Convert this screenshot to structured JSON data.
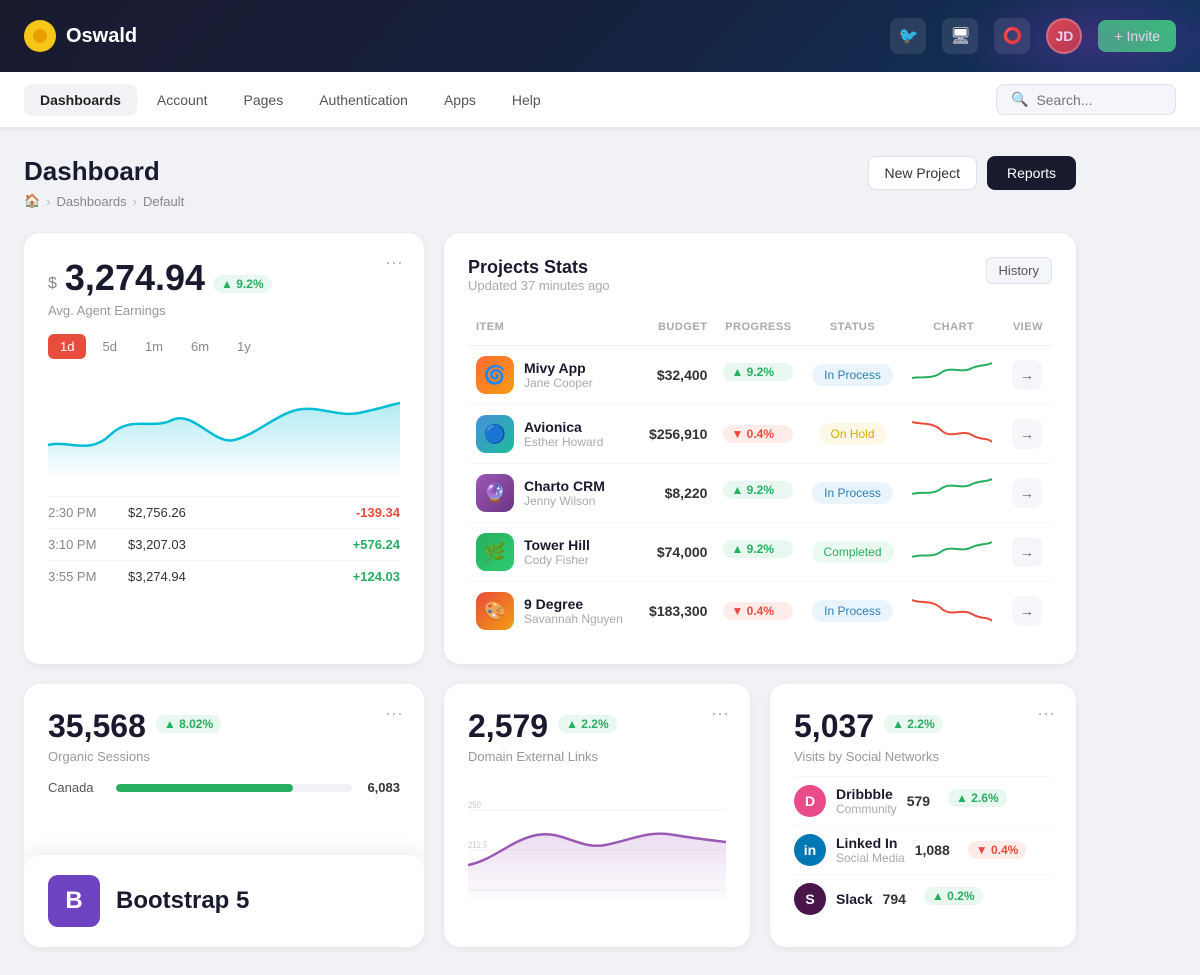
{
  "header": {
    "logo_text": "Oswald",
    "invite_label": "+ Invite"
  },
  "nav": {
    "items": [
      {
        "id": "dashboards",
        "label": "Dashboards",
        "active": true
      },
      {
        "id": "account",
        "label": "Account",
        "active": false
      },
      {
        "id": "pages",
        "label": "Pages",
        "active": false
      },
      {
        "id": "authentication",
        "label": "Authentication",
        "active": false
      },
      {
        "id": "apps",
        "label": "Apps",
        "active": false
      },
      {
        "id": "help",
        "label": "Help",
        "active": false
      }
    ],
    "search_placeholder": "Search..."
  },
  "page": {
    "title": "Dashboard",
    "breadcrumb": [
      "🏠",
      "Dashboards",
      "Default"
    ],
    "btn_new_project": "New Project",
    "btn_reports": "Reports"
  },
  "earnings_card": {
    "currency": "$",
    "amount": "3,274.94",
    "badge": "▲ 9.2%",
    "subtitle": "Avg. Agent Earnings",
    "time_filters": [
      "1d",
      "5d",
      "1m",
      "6m",
      "1y"
    ],
    "active_filter": "1d",
    "rows": [
      {
        "time": "2:30 PM",
        "value": "$2,756.26",
        "change": "-139.34",
        "positive": false
      },
      {
        "time": "3:10 PM",
        "value": "$3,207.03",
        "change": "+576.24",
        "positive": true
      },
      {
        "time": "3:55 PM",
        "value": "$3,274.94",
        "change": "+124.03",
        "positive": true
      }
    ]
  },
  "projects_card": {
    "title": "Projects Stats",
    "updated": "Updated 37 minutes ago",
    "btn_history": "History",
    "columns": [
      "ITEM",
      "BUDGET",
      "PROGRESS",
      "STATUS",
      "CHART",
      "VIEW"
    ],
    "rows": [
      {
        "name": "Mivy App",
        "person": "Jane Cooper",
        "budget": "$32,400",
        "progress": "▲ 9.2%",
        "progress_up": true,
        "status": "In Process",
        "status_class": "status-in-process",
        "icon": "🌀",
        "icon_bg": "#ff6b35"
      },
      {
        "name": "Avionica",
        "person": "Esther Howard",
        "budget": "$256,910",
        "progress": "▼ 0.4%",
        "progress_up": false,
        "status": "On Hold",
        "status_class": "status-on-hold",
        "icon": "🔵",
        "icon_bg": "#4a90d9"
      },
      {
        "name": "Charto CRM",
        "person": "Jenny Wilson",
        "budget": "$8,220",
        "progress": "▲ 9.2%",
        "progress_up": true,
        "status": "In Process",
        "status_class": "status-in-process",
        "icon": "🔮",
        "icon_bg": "#9b59b6"
      },
      {
        "name": "Tower Hill",
        "person": "Cody Fisher",
        "budget": "$74,000",
        "progress": "▲ 9.2%",
        "progress_up": true,
        "status": "Completed",
        "status_class": "status-completed",
        "icon": "🌿",
        "icon_bg": "#27ae60"
      },
      {
        "name": "9 Degree",
        "person": "Savannah Nguyen",
        "budget": "$183,300",
        "progress": "▼ 0.4%",
        "progress_up": false,
        "status": "In Process",
        "status_class": "status-in-process",
        "icon": "🎨",
        "icon_bg": "#e74c3c"
      }
    ]
  },
  "organic_card": {
    "number": "35,568",
    "badge": "▲ 8.02%",
    "badge_positive": true,
    "label": "Organic Sessions",
    "geo_items": [
      {
        "name": "Canada",
        "value": "6,083",
        "pct": 75
      }
    ]
  },
  "domain_card": {
    "number": "2,579",
    "badge": "▲ 2.2%",
    "badge_positive": true,
    "label": "Domain External Links"
  },
  "social_card": {
    "number": "5,037",
    "badge": "▲ 2.2%",
    "badge_positive": true,
    "label": "Visits by Social Networks",
    "networks": [
      {
        "name": "Dribbble",
        "sub": "Community",
        "count": "579",
        "change": "▲ 2.6%",
        "positive": true,
        "color": "#ea4c89"
      },
      {
        "name": "Linked In",
        "sub": "Social Media",
        "count": "1,088",
        "change": "▼ 0.4%",
        "positive": false,
        "color": "#0077b5"
      },
      {
        "name": "Slack",
        "sub": "",
        "count": "794",
        "change": "▲ 0.2%",
        "positive": true,
        "color": "#4a154b"
      }
    ]
  },
  "bootstrap_overlay": {
    "icon": "B",
    "text": "Bootstrap 5"
  }
}
